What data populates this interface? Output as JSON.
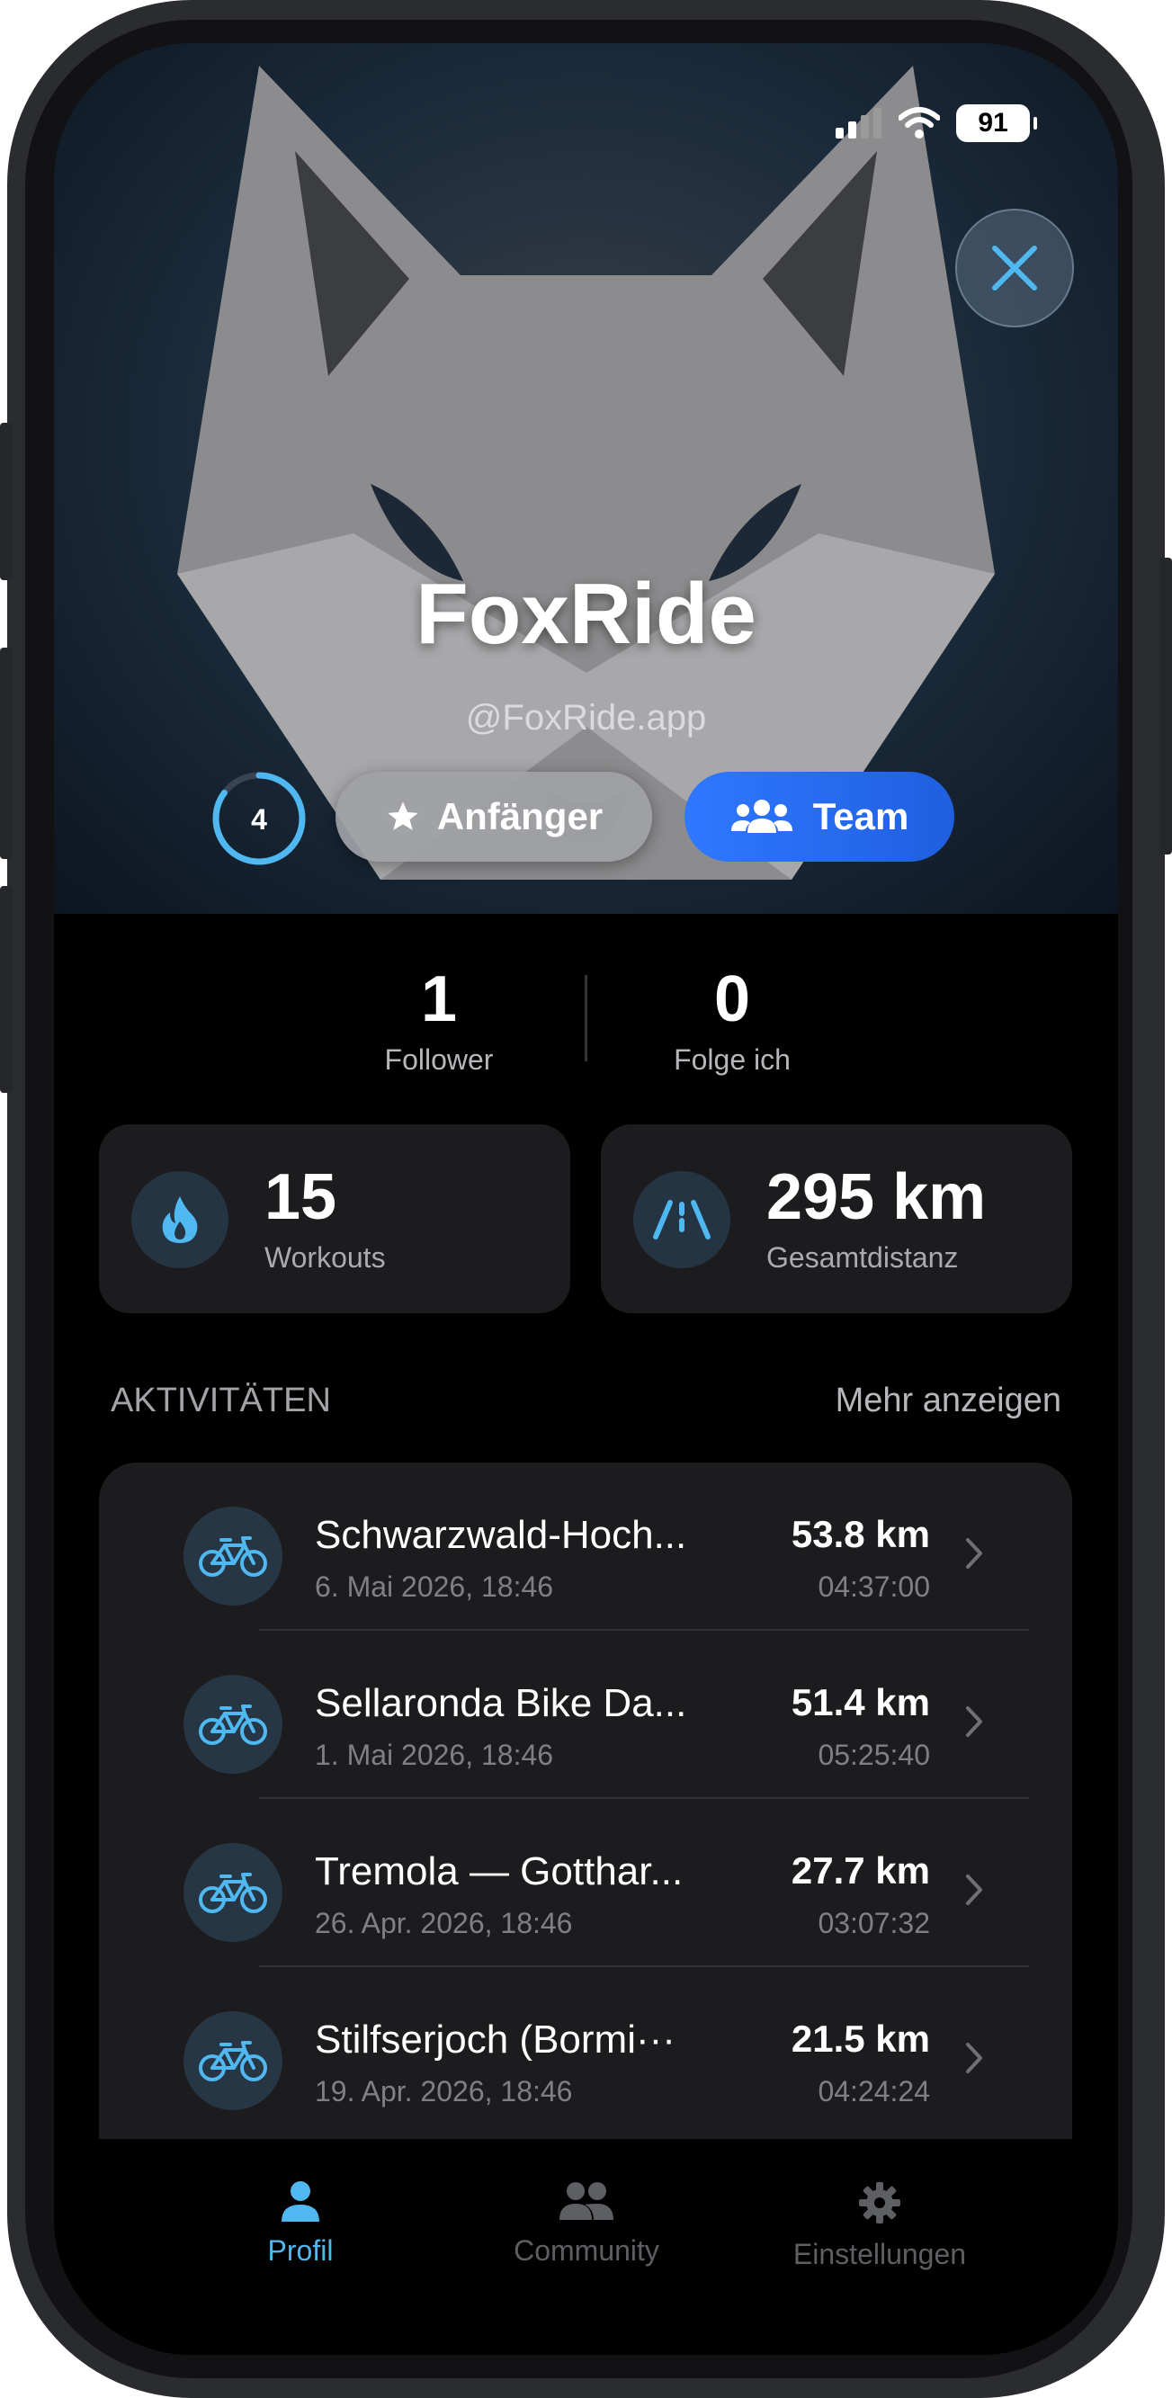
{
  "status_bar": {
    "battery": "91"
  },
  "profile": {
    "name": "FoxRide",
    "handle": "@FoxRide.app",
    "level": "4",
    "rank_label": "Anfänger",
    "team_label": "Team",
    "level_progress": 0.85
  },
  "follow": {
    "followers_count": "1",
    "followers_label": "Follower",
    "following_count": "0",
    "following_label": "Folge ich"
  },
  "stats": {
    "workouts_value": "15",
    "workouts_label": "Workouts",
    "distance_value": "295 km",
    "distance_label": "Gesamtdistanz"
  },
  "activities": {
    "section_title": "AKTIVITÄTEN",
    "more_label": "Mehr anzeigen",
    "items": [
      {
        "title": "Schwarzwald-Hoch...",
        "date": "6. Mai 2026, 18:46",
        "distance": "53.8 km",
        "duration": "04:37:00"
      },
      {
        "title": "Sellaronda Bike Da...",
        "date": "1. Mai 2026, 18:46",
        "distance": "51.4 km",
        "duration": "05:25:40"
      },
      {
        "title": "Tremola — Gotthar...",
        "date": "26. Apr. 2026, 18:46",
        "distance": "27.7 km",
        "duration": "03:07:32"
      },
      {
        "title": "Stilfserjoch (Bormi···",
        "date": "19. Apr. 2026, 18:46",
        "distance": "21.5 km",
        "duration": "04:24:24"
      }
    ]
  },
  "tabs": [
    {
      "label": "Profil",
      "icon": "person-icon",
      "active": true
    },
    {
      "label": "Community",
      "icon": "people-icon",
      "active": false
    },
    {
      "label": "Einstellungen",
      "icon": "gear-icon",
      "active": false
    }
  ],
  "colors": {
    "accent": "#4fb8f0",
    "team_blue": "#2f78ff",
    "card": "#1c1c1e",
    "background": "#000000"
  }
}
